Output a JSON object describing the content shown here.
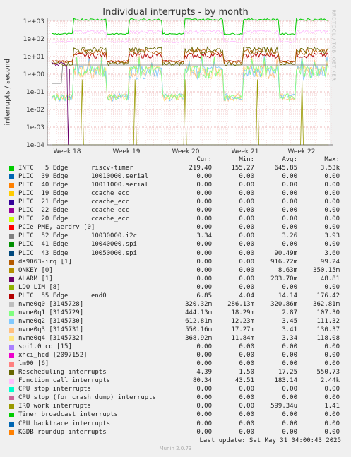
{
  "chart_data": {
    "type": "line",
    "title": "Individual interrupts - by month",
    "ylabel": "interrupts / second",
    "xlabel": "",
    "yscale": "log",
    "ylim": [
      0.0001,
      1000
    ],
    "y_ticks": [
      "1e-04",
      "1e-03",
      "1e-02",
      "1e-01",
      "1e+00",
      "1e+01",
      "1e+02",
      "1e+03"
    ],
    "x_ticks": [
      "Week 18",
      "Week 19",
      "Week 20",
      "Week 21",
      "Week 22"
    ],
    "grid": true,
    "series": [
      {
        "name": "INTC   5 Edge      riscv-timer",
        "color": "#00cc00",
        "cur": "219.40",
        "min": "155.27",
        "avg": "645.85",
        "max": "3.53k"
      },
      {
        "name": "PLIC  39 Edge      10010000.serial",
        "color": "#0066b3",
        "cur": "0.00",
        "min": "0.00",
        "avg": "0.00",
        "max": "0.00"
      },
      {
        "name": "PLIC  40 Edge      10011000.serial",
        "color": "#ff8000",
        "cur": "0.00",
        "min": "0.00",
        "avg": "0.00",
        "max": "0.00"
      },
      {
        "name": "PLIC  19 Edge      ccache_ecc",
        "color": "#ffcc00",
        "cur": "0.00",
        "min": "0.00",
        "avg": "0.00",
        "max": "0.00"
      },
      {
        "name": "PLIC  21 Edge      ccache_ecc",
        "color": "#330099",
        "cur": "0.00",
        "min": "0.00",
        "avg": "0.00",
        "max": "0.00"
      },
      {
        "name": "PLIC  22 Edge      ccache_ecc",
        "color": "#990099",
        "cur": "0.00",
        "min": "0.00",
        "avg": "0.00",
        "max": "0.00"
      },
      {
        "name": "PLIC  20 Edge      ccache_ecc",
        "color": "#ccff00",
        "cur": "0.00",
        "min": "0.00",
        "avg": "0.00",
        "max": "0.00"
      },
      {
        "name": "PCIe PME, aerdrv [0]",
        "color": "#ff0000",
        "cur": "0.00",
        "min": "0.00",
        "avg": "0.00",
        "max": "0.00"
      },
      {
        "name": "PLIC  52 Edge      10030000.i2c",
        "color": "#808080",
        "cur": "3.34",
        "min": "0.00",
        "avg": "3.26",
        "max": "3.93"
      },
      {
        "name": "PLIC  41 Edge      10040000.spi",
        "color": "#008f00",
        "cur": "0.00",
        "min": "0.00",
        "avg": "0.00",
        "max": "0.00"
      },
      {
        "name": "PLIC  43 Edge      10050000.spi",
        "color": "#00487d",
        "cur": "0.00",
        "min": "0.00",
        "avg": "90.49m",
        "max": "3.60"
      },
      {
        "name": "da9063-irq [1]",
        "color": "#b35a00",
        "cur": "0.00",
        "min": "0.00",
        "avg": "916.72m",
        "max": "99.24"
      },
      {
        "name": "ONKEY [0]",
        "color": "#b38f00",
        "cur": "0.00",
        "min": "0.00",
        "avg": "8.63m",
        "max": "350.15m"
      },
      {
        "name": "ALARM [1]",
        "color": "#6b006b",
        "cur": "0.00",
        "min": "0.00",
        "avg": "203.70m",
        "max": "48.81"
      },
      {
        "name": "LDO_LIM [8]",
        "color": "#8fb300",
        "cur": "0.00",
        "min": "0.00",
        "avg": "0.00",
        "max": "0.00"
      },
      {
        "name": "PLIC  55 Edge      end0",
        "color": "#b30000",
        "cur": "6.85",
        "min": "4.04",
        "avg": "14.14",
        "max": "176.42"
      },
      {
        "name": "nvme0q0 [3145728]",
        "color": "#bebebe",
        "cur": "320.32m",
        "min": "286.13m",
        "avg": "320.86m",
        "max": "362.81m"
      },
      {
        "name": "nvme0q1 [3145729]",
        "color": "#80ff80",
        "cur": "444.13m",
        "min": "18.29m",
        "avg": "2.87",
        "max": "107.30"
      },
      {
        "name": "nvme0q2 [3145730]",
        "color": "#80c9ff",
        "cur": "612.81m",
        "min": "12.23m",
        "avg": "3.45",
        "max": "111.32"
      },
      {
        "name": "nvme0q3 [3145731]",
        "color": "#ffc080",
        "cur": "550.16m",
        "min": "17.27m",
        "avg": "3.41",
        "max": "130.37"
      },
      {
        "name": "nvme0q4 [3145732]",
        "color": "#ffe680",
        "cur": "368.92m",
        "min": "11.84m",
        "avg": "3.34",
        "max": "118.08"
      },
      {
        "name": "spi1.0 cd [15]",
        "color": "#aa80ff",
        "cur": "0.00",
        "min": "0.00",
        "avg": "0.00",
        "max": "0.00"
      },
      {
        "name": "xhci_hcd [2097152]",
        "color": "#ee00cc",
        "cur": "0.00",
        "min": "0.00",
        "avg": "0.00",
        "max": "0.00"
      },
      {
        "name": "lm90 [6]",
        "color": "#ff8080",
        "cur": "0.00",
        "min": "0.00",
        "avg": "0.00",
        "max": "0.00"
      },
      {
        "name": "Rescheduling interrupts",
        "color": "#666600",
        "cur": "4.39",
        "min": "1.50",
        "avg": "17.25",
        "max": "550.73"
      },
      {
        "name": "Function call interrupts",
        "color": "#ffbfff",
        "cur": "80.34",
        "min": "43.51",
        "avg": "183.14",
        "max": "2.44k"
      },
      {
        "name": "CPU stop interrupts",
        "color": "#00ffcc",
        "cur": "0.00",
        "min": "0.00",
        "avg": "0.00",
        "max": "0.00"
      },
      {
        "name": "CPU stop (for crash dump) interrupts",
        "color": "#cc6699",
        "cur": "0.00",
        "min": "0.00",
        "avg": "0.00",
        "max": "0.00"
      },
      {
        "name": "IRQ work interrupts",
        "color": "#999900",
        "cur": "0.00",
        "min": "0.00",
        "avg": "599.34u",
        "max": "1.41"
      },
      {
        "name": "Timer broadcast interrupts",
        "color": "#00cc00",
        "cur": "0.00",
        "min": "0.00",
        "avg": "0.00",
        "max": "0.00"
      },
      {
        "name": "CPU backtrace interrupts",
        "color": "#0066b3",
        "cur": "0.00",
        "min": "0.00",
        "avg": "0.00",
        "max": "0.00"
      },
      {
        "name": "KGDB roundup interrupts",
        "color": "#ff8000",
        "cur": "0.00",
        "min": "0.00",
        "avg": "0.00",
        "max": "0.00"
      }
    ]
  },
  "legend_headers": {
    "cur": "Cur:",
    "min": "Min:",
    "avg": "Avg:",
    "max": "Max:"
  },
  "side_tag": "RRDTOOL / TOBI OETIKER",
  "last_update": "Last update: Sat May 31 04:00:43 2025",
  "generator": "Munin 2.0.73"
}
